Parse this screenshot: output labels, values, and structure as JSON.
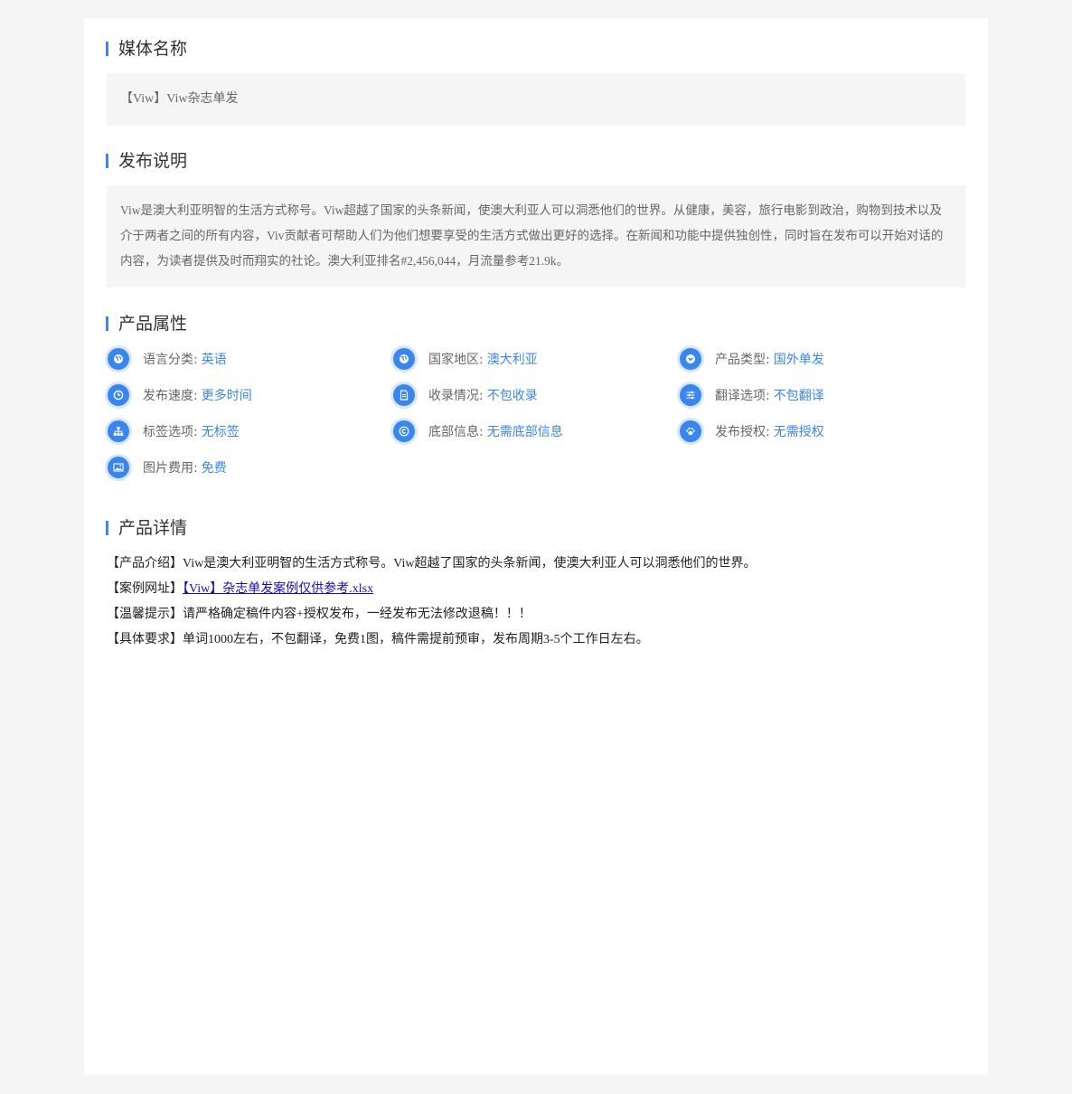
{
  "sections": {
    "media_title": "媒体名称",
    "publish_title": "发布说明",
    "attributes_title": "产品属性",
    "details_title": "产品详情"
  },
  "media_name": "【Viw】Viw杂志单发",
  "publish_description": "Viw是澳大利亚明智的生活方式称号。Viw超越了国家的头条新闻，使澳大利亚人可以洞悉他们的世界。从健康，美容，旅行电影到政治，购物到技术以及介于两者之间的所有内容，Viv贡献者可帮助人们为他们想要享受的生活方式做出更好的选择。在新闻和功能中提供独创性，同时旨在发布可以开始对话的内容，为读者提供及时而翔实的社论。澳大利亚排名#2,456,044，月流量参考21.9k。",
  "attributes": [
    {
      "icon": "globe-icon",
      "label": "语言分类:",
      "value": "英语"
    },
    {
      "icon": "globe-icon",
      "label": "国家地区:",
      "value": "澳大利亚"
    },
    {
      "icon": "chevron-down-circle-icon",
      "label": "产品类型:",
      "value": "国外单发"
    },
    {
      "icon": "clock-icon",
      "label": "发布速度:",
      "value": "更多时间"
    },
    {
      "icon": "document-icon",
      "label": "收录情况:",
      "value": "不包收录"
    },
    {
      "icon": "sliders-icon",
      "label": "翻译选项:",
      "value": "不包翻译"
    },
    {
      "icon": "sitemap-icon",
      "label": "标签选项:",
      "value": "无标签"
    },
    {
      "icon": "copyright-icon",
      "label": "底部信息:",
      "value": "无需底部信息"
    },
    {
      "icon": "paw-icon",
      "label": "发布授权:",
      "value": "无需授权"
    },
    {
      "icon": "image-icon",
      "label": "图片费用:",
      "value": "免费"
    }
  ],
  "details": {
    "intro_label": "【产品介绍】",
    "intro_text": "Viw是澳大利亚明智的生活方式称号。Viw超越了国家的头条新闻，使澳大利亚人可以洞悉他们的世界。",
    "case_label": "【案例网址】",
    "case_link": "【Viw】杂志单发案例仅供参考.xlsx",
    "tip_label": "【温馨提示】",
    "tip_text": "请严格确定稿件内容+授权发布，一经发布无法修改退稿！！！",
    "req_label": "【具体要求】",
    "req_text": "单词1000左右，不包翻译，免费1图，稿件需提前预审，发布周期3-5个工作日左右。"
  },
  "colors": {
    "accent": "#3a86f0",
    "background": "#f5f5f5",
    "card": "#ffffff",
    "link": "#1a0dab"
  }
}
